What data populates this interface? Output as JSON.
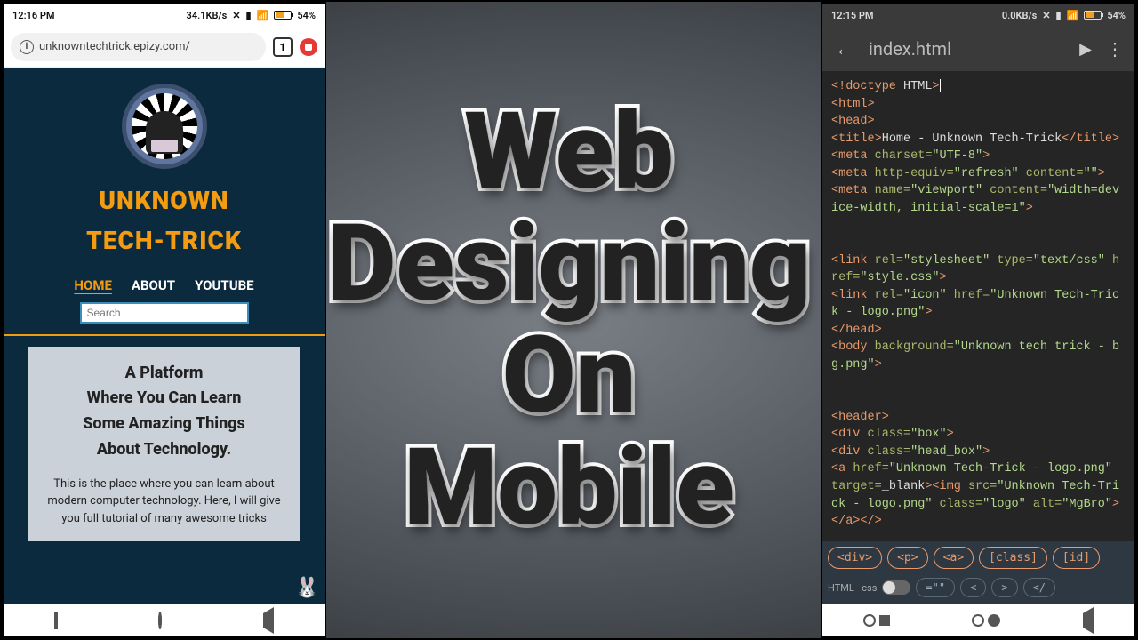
{
  "center_title": {
    "line1": "Web",
    "line2": "Designing",
    "line3": "On",
    "line4": "Mobile"
  },
  "left_phone": {
    "status": {
      "time": "12:16 PM",
      "net_speed": "34.1KB/s",
      "battery_pct": "54%"
    },
    "url": "unknowntechtrick.epizy.com/",
    "tab_count": "1",
    "site": {
      "title_line1": "UNKNOWN",
      "title_line2": "TECH-TRICK",
      "nav": [
        "HOME",
        "ABOUT",
        "YOUTUBE"
      ],
      "active_nav": 0,
      "search_placeholder": "Search",
      "hero_heading": "A Platform\nWhere You Can Learn\nSome Amazing Things\nAbout Technology.",
      "hero_body": "This is the place where you can learn about modern computer technology. Here, I will give you full tutorial of many awesome tricks",
      "glow_text": "UNKNOWN"
    }
  },
  "right_phone": {
    "status": {
      "time": "12:15 PM",
      "net_speed": "0.0KB/s",
      "battery_pct": "54%"
    },
    "filename": "index.html",
    "chips_row1": [
      "<div>",
      "<p>",
      "<a>",
      "[class]",
      "[id]"
    ],
    "lang_label": "HTML - css",
    "chips_row2": [
      "=\"\"",
      "<",
      ">",
      "</"
    ],
    "code_lines": [
      [
        [
          "tag",
          "<!doctype "
        ],
        [
          "txt",
          "HTML"
        ],
        [
          "tag",
          ">"
        ]
      ],
      [
        [
          "tag",
          "<html>"
        ]
      ],
      [
        [
          "tag",
          "<head>"
        ]
      ],
      [
        [
          "tag",
          "<title>"
        ],
        [
          "txt",
          "Home - Unknown Tech-Trick"
        ],
        [
          "tag",
          "</title>"
        ]
      ],
      [
        [
          "tag",
          "<meta "
        ],
        [
          "attr",
          "charset="
        ],
        [
          "str",
          "\"UTF-8\""
        ],
        [
          "tag",
          ">"
        ]
      ],
      [
        [
          "tag",
          "<meta "
        ],
        [
          "attr",
          "http-equiv="
        ],
        [
          "str",
          "\"refresh\""
        ],
        [
          "tag",
          " "
        ],
        [
          "attr",
          "content="
        ],
        [
          "str",
          "\"\""
        ],
        [
          "tag",
          ">"
        ]
      ],
      [
        [
          "tag",
          "<meta "
        ],
        [
          "attr",
          "name="
        ],
        [
          "str",
          "\"viewport\""
        ],
        [
          "tag",
          " "
        ],
        [
          "attr",
          "content="
        ],
        [
          "str",
          "\"width=device-width, initial-scale=1\""
        ],
        [
          "tag",
          ">"
        ]
      ],
      [],
      [
        [
          "tag",
          "<link "
        ],
        [
          "attr",
          "rel="
        ],
        [
          "str",
          "\"stylesheet\""
        ],
        [
          "tag",
          " "
        ],
        [
          "attr",
          "type="
        ],
        [
          "str",
          "\"text/css\""
        ],
        [
          "tag",
          " "
        ],
        [
          "attr",
          "href="
        ],
        [
          "str",
          "\"style.css\""
        ],
        [
          "tag",
          ">"
        ]
      ],
      [
        [
          "tag",
          "<link "
        ],
        [
          "attr",
          "rel="
        ],
        [
          "str",
          "\"icon\""
        ],
        [
          "tag",
          " "
        ],
        [
          "attr",
          "href="
        ],
        [
          "str",
          "\"Unknown Tech-Trick - logo.png\""
        ],
        [
          "tag",
          ">"
        ]
      ],
      [
        [
          "tag",
          "</head>"
        ]
      ],
      [
        [
          "tag",
          "<body "
        ],
        [
          "attr",
          "background="
        ],
        [
          "str",
          "\"Unknown tech trick - bg.png\""
        ],
        [
          "tag",
          ">"
        ]
      ],
      [],
      [
        [
          "tag",
          "<header>"
        ]
      ],
      [
        [
          "tag",
          "<div "
        ],
        [
          "attr",
          "class="
        ],
        [
          "str",
          "\"box\""
        ],
        [
          "tag",
          ">"
        ]
      ],
      [
        [
          "tag",
          "<div "
        ],
        [
          "attr",
          "class="
        ],
        [
          "str",
          "\"head_box\""
        ],
        [
          "tag",
          ">"
        ]
      ],
      [
        [
          "tag",
          "<a "
        ],
        [
          "attr",
          "href="
        ],
        [
          "str",
          "\"Unknown Tech-Trick - logo.png\""
        ],
        [
          "tag",
          " "
        ],
        [
          "attr",
          "target="
        ],
        [
          "txt",
          "_blank"
        ],
        [
          "tag",
          "><img "
        ],
        [
          "attr",
          "src="
        ],
        [
          "str",
          "\"Unknown Tech-Trick - logo.png\""
        ],
        [
          "tag",
          " "
        ],
        [
          "attr",
          "class="
        ],
        [
          "str",
          "\"logo\""
        ],
        [
          "tag",
          " "
        ],
        [
          "attr",
          "alt="
        ],
        [
          "str",
          "\"MgBro\""
        ],
        [
          "tag",
          "></a></>"
        ]
      ]
    ]
  }
}
